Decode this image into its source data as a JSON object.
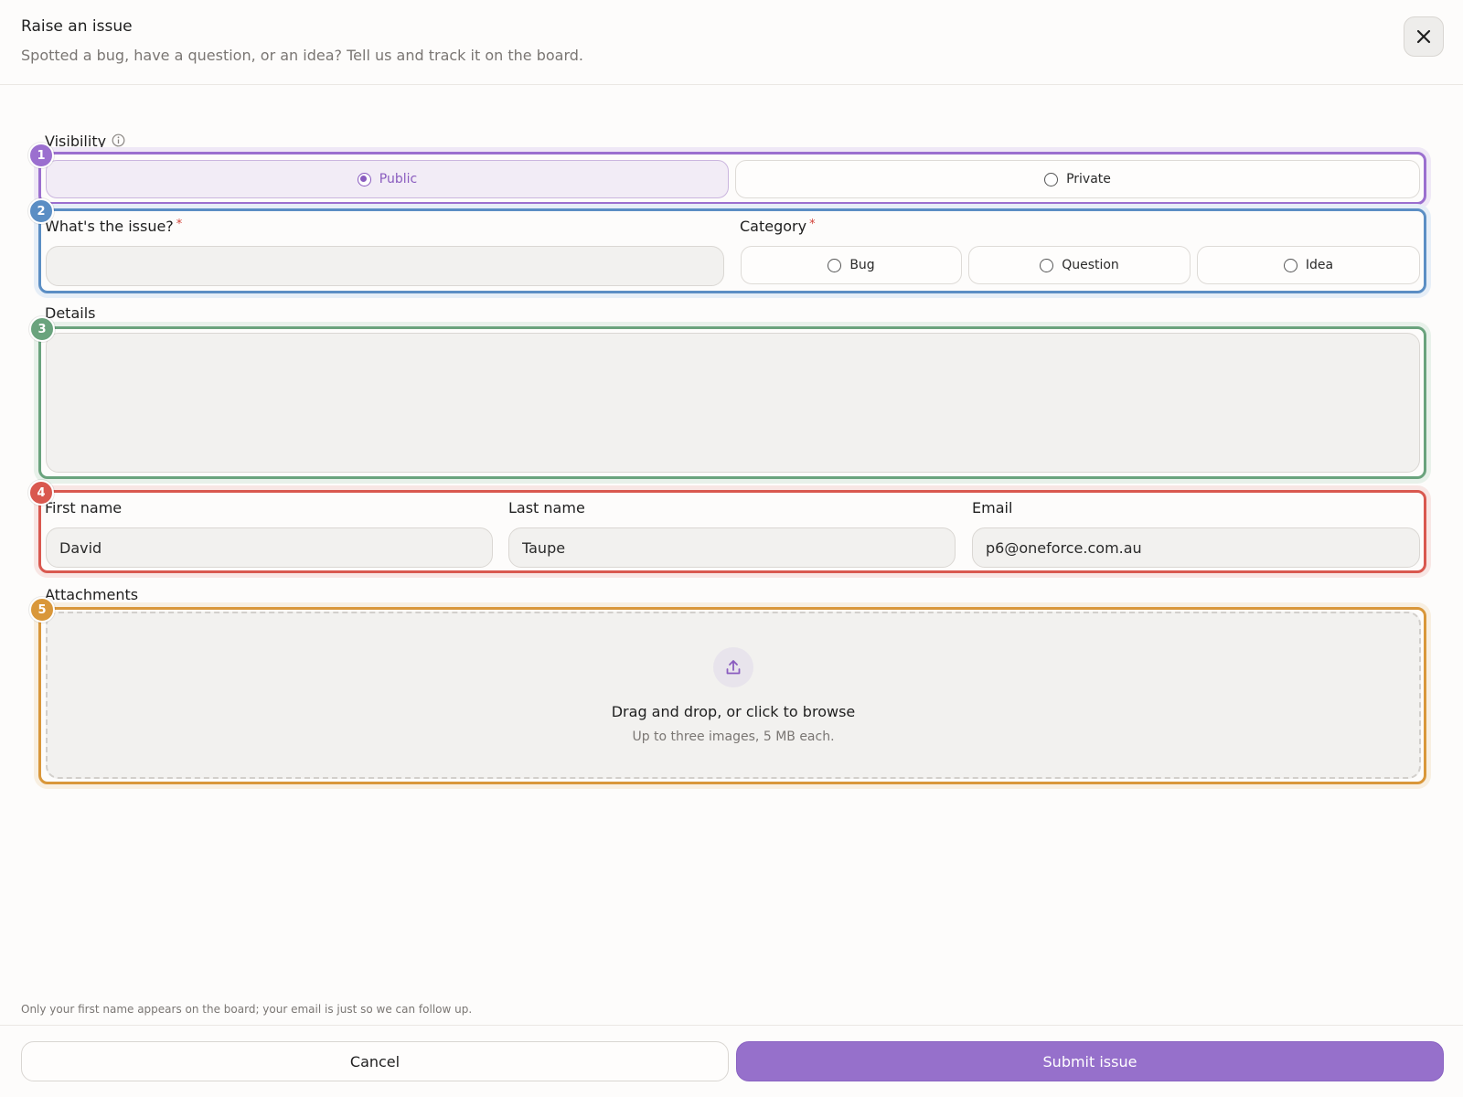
{
  "header": {
    "title": "Raise an issue",
    "subtitle": "Spotted a bug, have a question, or an idea? Tell us and track it on the board."
  },
  "visibility": {
    "label": "Visibility",
    "options": [
      "Public",
      "Private"
    ],
    "selected": "Public"
  },
  "issue": {
    "label": "What's the issue?",
    "required_mark": "*",
    "value": ""
  },
  "category": {
    "label": "Category",
    "required_mark": "*",
    "options": [
      "Bug",
      "Question",
      "Idea"
    ]
  },
  "details": {
    "label": "Details",
    "value": ""
  },
  "contact": {
    "first_name_label": "First name",
    "first_name_value": "David",
    "last_name_label": "Last name",
    "last_name_value": "Taupe",
    "email_label": "Email",
    "email_value": "p6@oneforce.com.au"
  },
  "attachments": {
    "label": "Attachments",
    "dropzone_title": "Drag and drop, or click to browse",
    "dropzone_hint": "Up to three images, 5 MB each."
  },
  "annotations": {
    "badges": [
      "1",
      "2",
      "3",
      "4",
      "5"
    ],
    "colors": [
      "#9b6fcf",
      "#5b8ec4",
      "#6aa37d",
      "#d9584f",
      "#d9973a"
    ]
  },
  "footer": {
    "note": "Only your first name appears on the board; your email is just so we can follow up.",
    "cancel_label": "Cancel",
    "submit_label": "Submit issue"
  },
  "colors": {
    "accent": "#9670cb",
    "required": "#d2433a"
  }
}
